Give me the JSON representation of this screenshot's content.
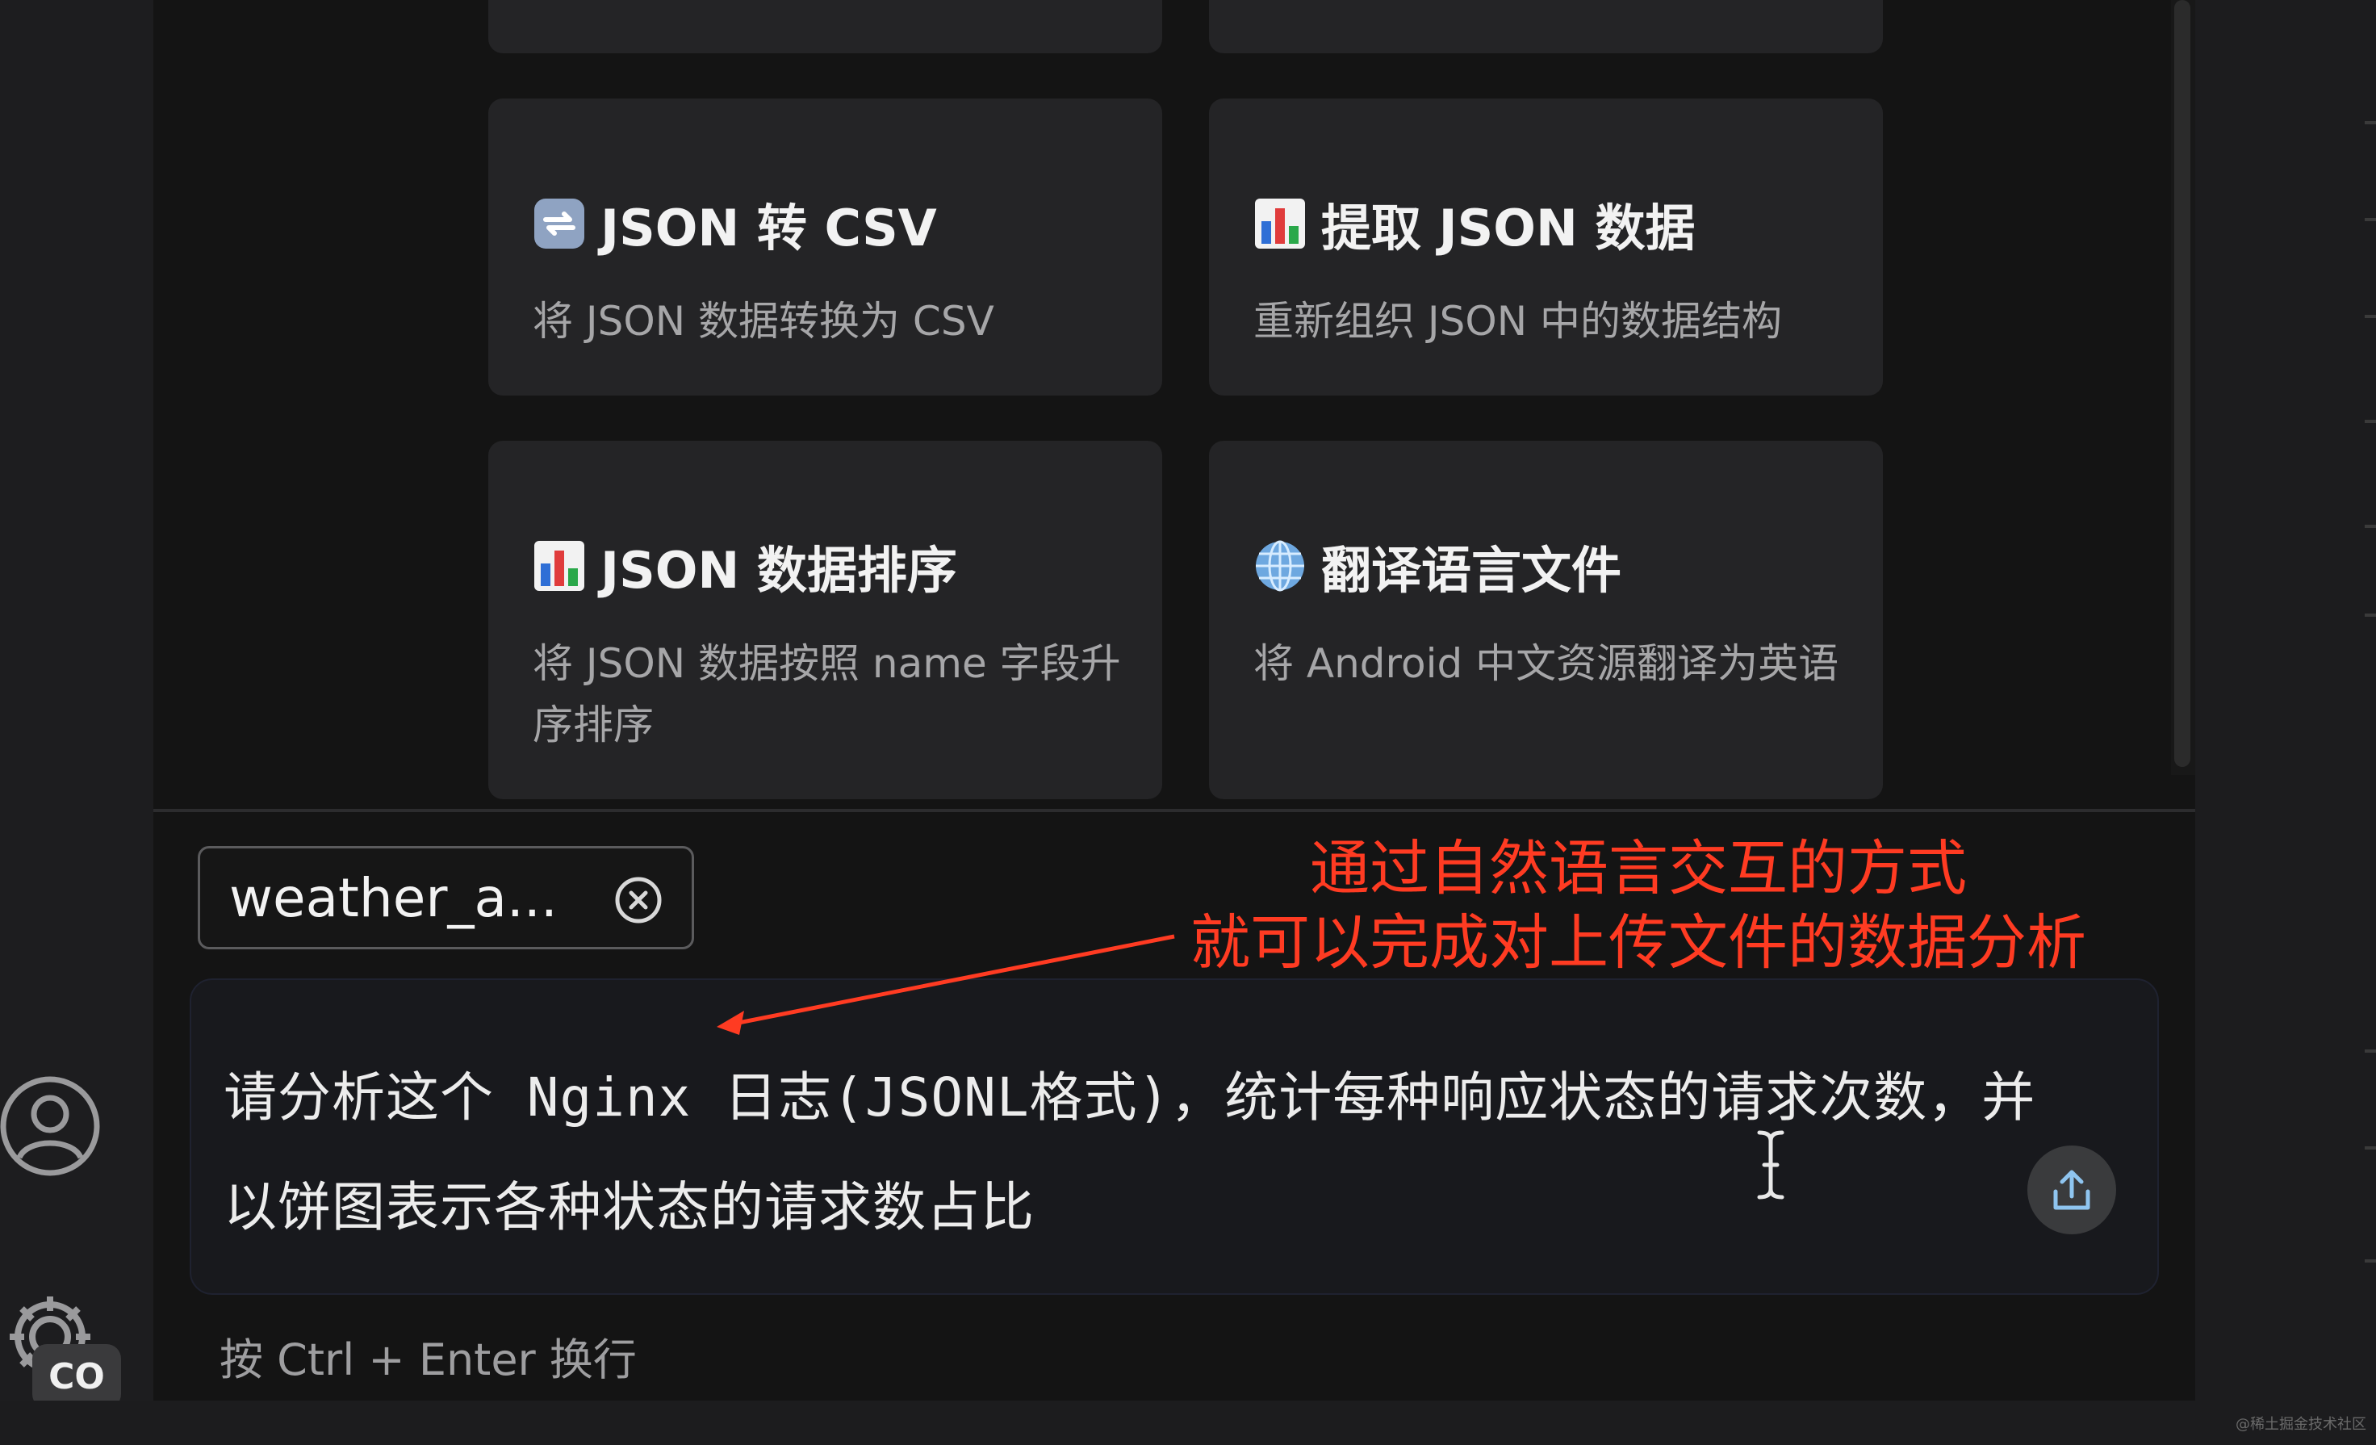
{
  "cards": [
    {
      "icon": "convert-arrows-icon",
      "title": "JSON 转 CSV",
      "description": "将 JSON 数据转换为 CSV"
    },
    {
      "icon": "bar-chart-icon",
      "title": "提取 JSON 数据",
      "description": "重新组织 JSON 中的数据结构"
    },
    {
      "icon": "bar-chart-icon",
      "title": "JSON 数据排序",
      "description": "将 JSON 数据按照 name 字段升序排序"
    },
    {
      "icon": "globe-icon",
      "title": "翻译语言文件",
      "description": "将 Android 中文资源翻译为英语"
    }
  ],
  "attachment": {
    "filename": "weather_a...",
    "close_icon": "close-circle-icon"
  },
  "prompt_input": {
    "value": "请分析这个 Nginx 日志(JSONL格式)，统计每种响应状态的请求次数，并以饼图表示各种状态的请求数占比",
    "send_icon": "upload-icon"
  },
  "hint": "按 Ctrl + Enter 换行",
  "annotation": {
    "line1": "通过自然语言交互的方式",
    "line2": "就可以完成对上传文件的数据分析",
    "color": "#ff3b22"
  },
  "sidebar": {
    "account_icon": "account-icon",
    "settings_icon": "gear-icon",
    "badge": "CO"
  },
  "watermark": "@稀土掘金技术社区"
}
